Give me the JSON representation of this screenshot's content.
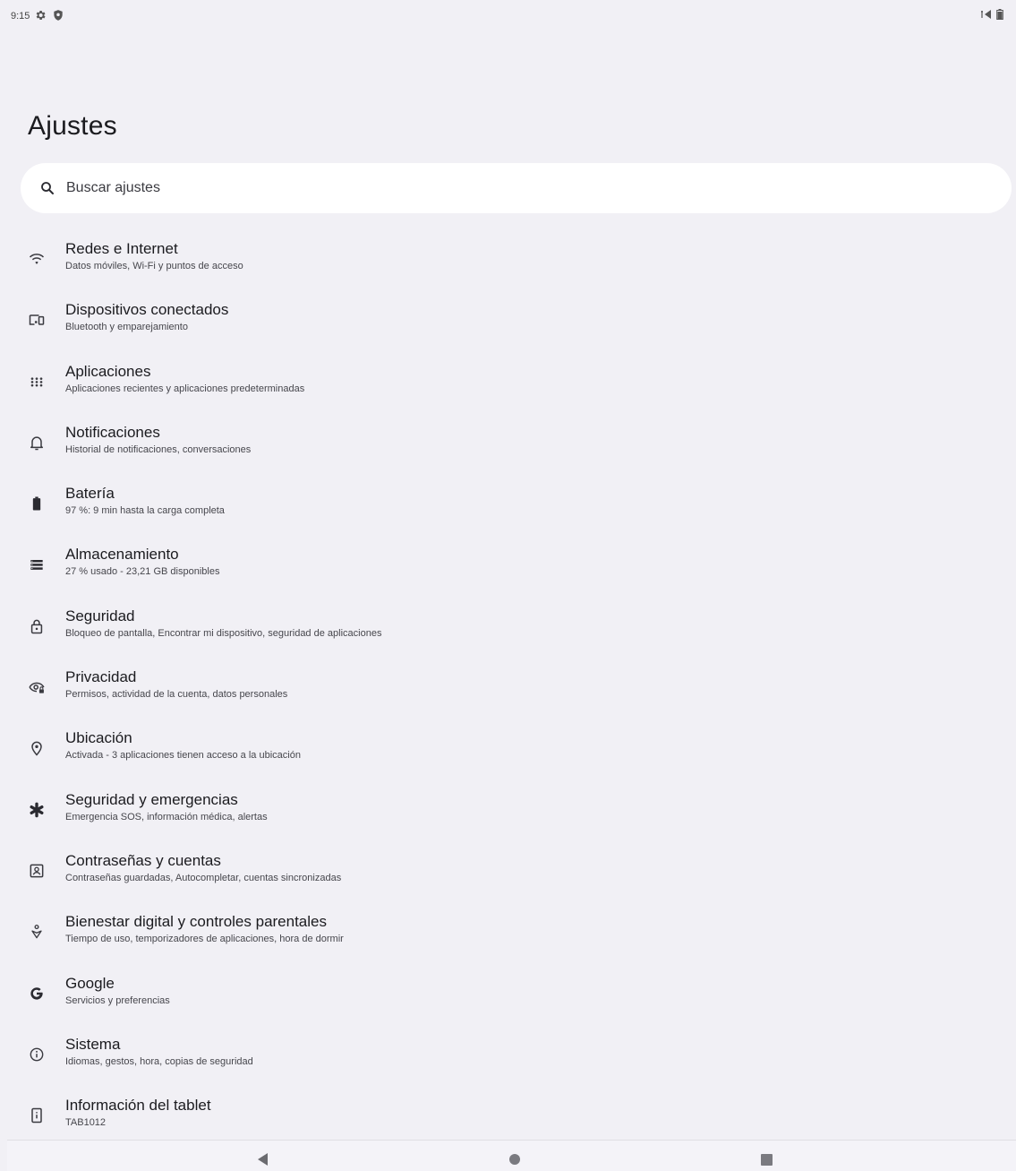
{
  "status_bar": {
    "time": "9:15",
    "icons_left": [
      "settings-gear-icon",
      "shield-icon"
    ],
    "icons_right": [
      "signal-icon",
      "battery-icon"
    ]
  },
  "header": {
    "title": "Ajustes"
  },
  "search": {
    "placeholder": "Buscar ajustes",
    "icon": "search-icon"
  },
  "settings": [
    {
      "icon": "wifi-icon",
      "title": "Redes e Internet",
      "subtitle": "Datos móviles, Wi-Fi y puntos de acceso"
    },
    {
      "icon": "connected-devices-icon",
      "title": "Dispositivos conectados",
      "subtitle": "Bluetooth y emparejamiento"
    },
    {
      "icon": "apps-grid-icon",
      "title": "Aplicaciones",
      "subtitle": "Aplicaciones recientes y aplicaciones predeterminadas"
    },
    {
      "icon": "bell-icon",
      "title": "Notificaciones",
      "subtitle": "Historial de notificaciones, conversaciones"
    },
    {
      "icon": "battery-icon",
      "title": "Batería",
      "subtitle": "97 %: 9 min hasta la carga completa"
    },
    {
      "icon": "storage-icon",
      "title": "Almacenamiento",
      "subtitle": "27 % usado - 23,21 GB disponibles"
    },
    {
      "icon": "lock-icon",
      "title": "Seguridad",
      "subtitle": "Bloqueo de pantalla, Encontrar mi dispositivo, seguridad de aplicaciones"
    },
    {
      "icon": "privacy-eye-icon",
      "title": "Privacidad",
      "subtitle": "Permisos, actividad de la cuenta, datos personales"
    },
    {
      "icon": "location-pin-icon",
      "title": "Ubicación",
      "subtitle": "Activada - 3 aplicaciones tienen acceso a la ubicación"
    },
    {
      "icon": "emergency-asterisk-icon",
      "title": "Seguridad y emergencias",
      "subtitle": "Emergencia SOS, información médica, alertas"
    },
    {
      "icon": "account-box-icon",
      "title": "Contraseñas y cuentas",
      "subtitle": "Contraseñas guardadas, Autocompletar, cuentas sincronizadas"
    },
    {
      "icon": "wellbeing-icon",
      "title": "Bienestar digital y controles parentales",
      "subtitle": "Tiempo de uso, temporizadores de aplicaciones, hora de dormir"
    },
    {
      "icon": "google-g-icon",
      "title": "Google",
      "subtitle": "Servicios y preferencias"
    },
    {
      "icon": "info-icon",
      "title": "Sistema",
      "subtitle": "Idiomas, gestos, hora, copias de seguridad"
    },
    {
      "icon": "tablet-info-icon",
      "title": "Información del tablet",
      "subtitle": "TAB1012"
    }
  ],
  "nav_bar": {
    "buttons": [
      "back-icon",
      "home-icon",
      "recents-icon"
    ]
  }
}
